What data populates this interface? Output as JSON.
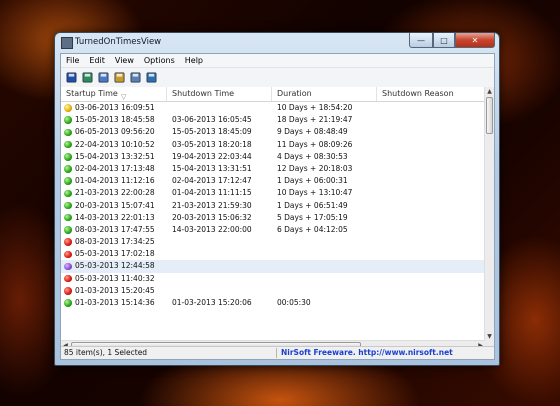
{
  "window": {
    "title": "TurnedOnTimesView"
  },
  "titlebar": {
    "minimize": "—",
    "maximize": "□",
    "close": "✕"
  },
  "menu": [
    "File",
    "Edit",
    "View",
    "Options",
    "Help"
  ],
  "toolbar": [
    {
      "name": "save-icon",
      "color": "#1f4fa8"
    },
    {
      "name": "export-icon",
      "color": "#2e8b57"
    },
    {
      "name": "copy-icon",
      "color": "#4a78c2"
    },
    {
      "name": "properties-icon",
      "color": "#c79a2a"
    },
    {
      "name": "report-icon",
      "color": "#5a7fb0"
    },
    {
      "name": "exit-icon",
      "color": "#2a6fb0"
    }
  ],
  "columns": [
    "Startup Time",
    "Shutdown Time",
    "Duration",
    "Shutdown Reason"
  ],
  "sort_indicator": "▽",
  "rows": [
    {
      "status": "yellow",
      "startup": "03-06-2013 16:09:51",
      "shutdown": "",
      "duration": "10 Days + 18:54:20"
    },
    {
      "status": "green",
      "startup": "15-05-2013 18:45:58",
      "shutdown": "03-06-2013 16:05:45",
      "duration": "18 Days + 21:19:47"
    },
    {
      "status": "green",
      "startup": "06-05-2013 09:56:20",
      "shutdown": "15-05-2013 18:45:09",
      "duration": "9 Days + 08:48:49"
    },
    {
      "status": "green",
      "startup": "22-04-2013 10:10:52",
      "shutdown": "03-05-2013 18:20:18",
      "duration": "11 Days + 08:09:26"
    },
    {
      "status": "green",
      "startup": "15-04-2013 13:32:51",
      "shutdown": "19-04-2013 22:03:44",
      "duration": "4 Days + 08:30:53"
    },
    {
      "status": "green",
      "startup": "02-04-2013 17:13:48",
      "shutdown": "15-04-2013 13:31:51",
      "duration": "12 Days + 20:18:03"
    },
    {
      "status": "green",
      "startup": "01-04-2013 11:12:16",
      "shutdown": "02-04-2013 17:12:47",
      "duration": "1 Days + 06:00:31"
    },
    {
      "status": "green",
      "startup": "21-03-2013 22:00:28",
      "shutdown": "01-04-2013 11:11:15",
      "duration": "10 Days + 13:10:47"
    },
    {
      "status": "green",
      "startup": "20-03-2013 15:07:41",
      "shutdown": "21-03-2013 21:59:30",
      "duration": "1 Days + 06:51:49"
    },
    {
      "status": "green",
      "startup": "14-03-2013 22:01:13",
      "shutdown": "20-03-2013 15:06:32",
      "duration": "5 Days + 17:05:19"
    },
    {
      "status": "green",
      "startup": "08-03-2013 17:47:55",
      "shutdown": "14-03-2013 22:00:00",
      "duration": "6 Days + 04:12:05"
    },
    {
      "status": "red",
      "startup": "08-03-2013 17:34:25",
      "shutdown": "",
      "duration": ""
    },
    {
      "status": "red",
      "startup": "05-03-2013 17:02:18",
      "shutdown": "",
      "duration": ""
    },
    {
      "status": "purple",
      "startup": "05-03-2013 12:44:58",
      "shutdown": "",
      "duration": "",
      "selected": true
    },
    {
      "status": "red",
      "startup": "05-03-2013 11:40:32",
      "shutdown": "",
      "duration": ""
    },
    {
      "status": "red",
      "startup": "01-03-2013 15:20:45",
      "shutdown": "",
      "duration": ""
    },
    {
      "status": "green",
      "startup": "01-03-2013 15:14:36",
      "shutdown": "01-03-2013 15:20:06",
      "duration": "00:05:30"
    }
  ],
  "statusbar": {
    "count": "85 item(s), 1 Selected",
    "link": "NirSoft Freeware.  http://www.nirsoft.net"
  },
  "colors": {
    "link": "#1a3fd0",
    "selected_row": "#e5eef8",
    "close_button": "#c7462f"
  }
}
